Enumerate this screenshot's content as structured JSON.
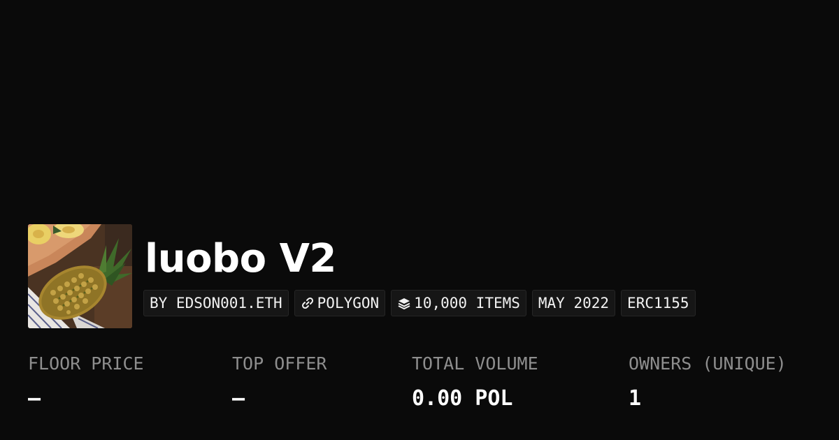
{
  "collection": {
    "title": "luobo V2",
    "avatar_icon": "pineapple-image"
  },
  "chips": {
    "creator": "BY EDSON001.ETH",
    "chain": "POLYGON",
    "chain_icon": "link-icon",
    "items": "10,000 ITEMS",
    "items_icon": "layers-icon",
    "date": "MAY 2022",
    "standard": "ERC1155"
  },
  "stats": {
    "floor_price": {
      "label": "FLOOR PRICE",
      "value": "–"
    },
    "top_offer": {
      "label": "TOP OFFER",
      "value": "–"
    },
    "total_volume": {
      "label": "TOTAL VOLUME",
      "value": "0.00 POL"
    },
    "owners": {
      "label": "OWNERS (UNIQUE)",
      "value": "1"
    }
  },
  "colors": {
    "background": "#0a0a0a",
    "chip_background": "#161616",
    "label_gray": "#8e8e8e",
    "text": "#ffffff"
  }
}
